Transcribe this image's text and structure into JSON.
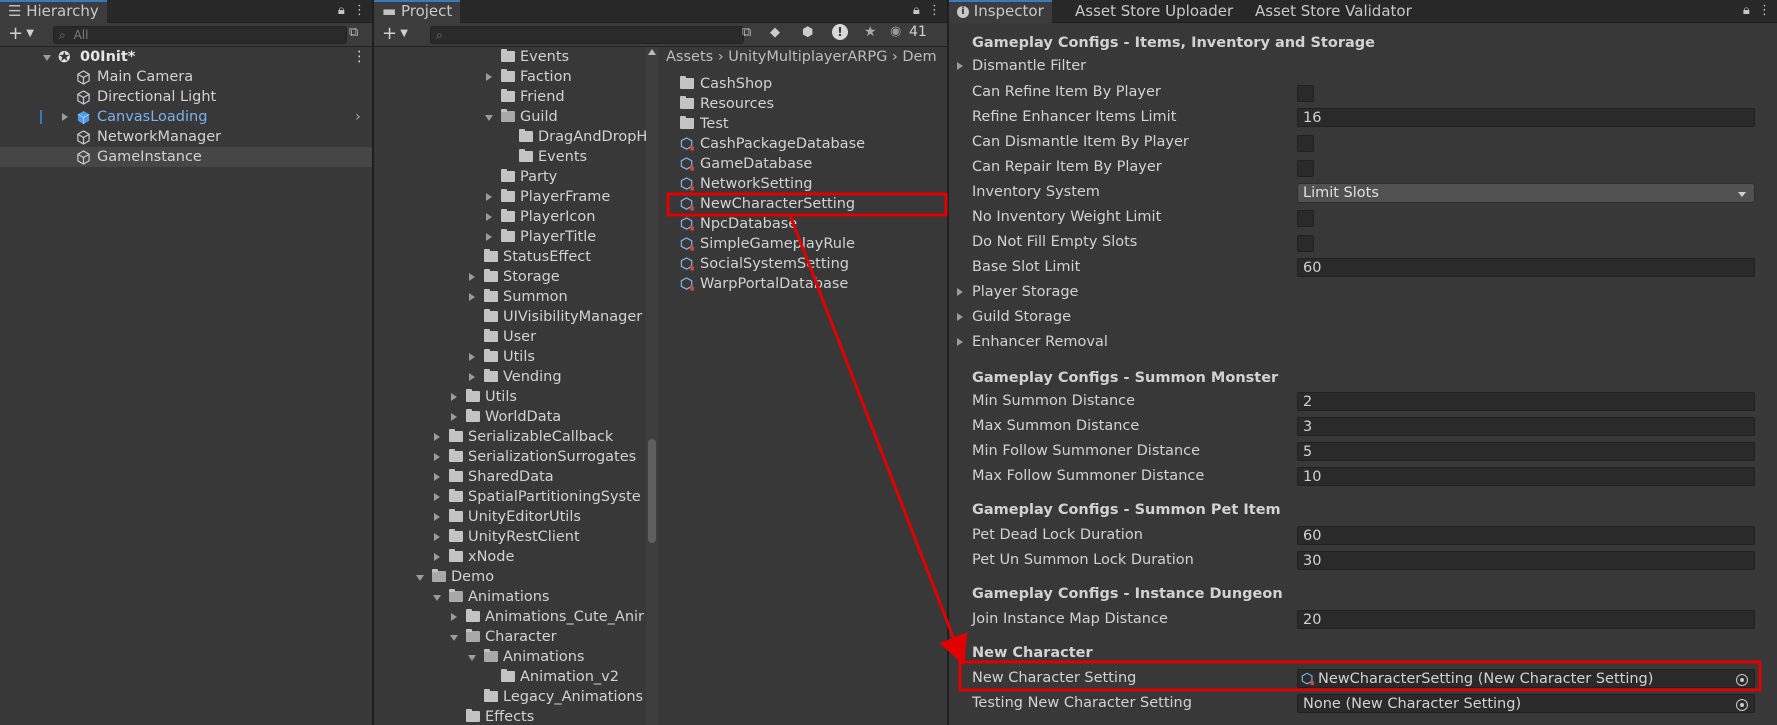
{
  "hierarchy": {
    "tab_label": "Hierarchy",
    "search_placeholder": "All",
    "scene": "00Init*",
    "items": [
      {
        "label": "Main Camera"
      },
      {
        "label": "Directional Light"
      },
      {
        "label": "CanvasLoading"
      },
      {
        "label": "NetworkManager"
      },
      {
        "label": "GameInstance"
      }
    ]
  },
  "project": {
    "tab_label": "Project",
    "hidden_count": "41",
    "breadcrumb": [
      "Assets",
      "UnityMultiplayerARPG",
      "Dem"
    ],
    "tree": [
      {
        "label": "Events"
      },
      {
        "label": "Faction"
      },
      {
        "label": "Friend"
      },
      {
        "label": "Guild"
      },
      {
        "label": "DragAndDropH"
      },
      {
        "label": "Events"
      },
      {
        "label": "Party"
      },
      {
        "label": "PlayerFrame"
      },
      {
        "label": "PlayerIcon"
      },
      {
        "label": "PlayerTitle"
      },
      {
        "label": "StatusEffect"
      },
      {
        "label": "Storage"
      },
      {
        "label": "Summon"
      },
      {
        "label": "UIVisibilityManager"
      },
      {
        "label": "User"
      },
      {
        "label": "Utils"
      },
      {
        "label": "Vending"
      },
      {
        "label": "Utils"
      },
      {
        "label": "WorldData"
      },
      {
        "label": "SerializableCallback"
      },
      {
        "label": "SerializationSurrogates"
      },
      {
        "label": "SharedData"
      },
      {
        "label": "SpatialPartitioningSyste"
      },
      {
        "label": "UnityEditorUtils"
      },
      {
        "label": "UnityRestClient"
      },
      {
        "label": "xNode"
      },
      {
        "label": "Demo"
      },
      {
        "label": "Animations"
      },
      {
        "label": "Animations_Cute_Anir"
      },
      {
        "label": "Character"
      },
      {
        "label": "Animations"
      },
      {
        "label": "Animation_v2"
      },
      {
        "label": "Legacy_Animations"
      },
      {
        "label": "Effects"
      }
    ],
    "assets": [
      {
        "label": "CashShop"
      },
      {
        "label": "Resources"
      },
      {
        "label": "Test"
      },
      {
        "label": "CashPackageDatabase"
      },
      {
        "label": "GameDatabase"
      },
      {
        "label": "NetworkSetting"
      },
      {
        "label": "NewCharacterSetting"
      },
      {
        "label": "NpcDatabase"
      },
      {
        "label": "SimpleGameplayRule"
      },
      {
        "label": "SocialSystemSetting"
      },
      {
        "label": "WarpPortalDatabase"
      }
    ]
  },
  "inspector": {
    "tabs": [
      "Inspector",
      "Asset Store Uploader",
      "Asset Store Validator"
    ],
    "headers": {
      "items": "Gameplay Configs - Items, Inventory and Storage",
      "summon_monster": "Gameplay Configs - Summon Monster",
      "summon_pet": "Gameplay Configs - Summon Pet Item",
      "dungeon": "Gameplay Configs - Instance Dungeon",
      "new_character": "New Character"
    },
    "dismantle_filter": "Dismantle Filter",
    "can_refine": "Can Refine Item By Player",
    "refine_limit": {
      "label": "Refine Enhancer Items Limit",
      "value": "16"
    },
    "can_dismantle": "Can Dismantle Item By Player",
    "can_repair": "Can Repair Item By Player",
    "inventory_system": {
      "label": "Inventory System",
      "value": "Limit Slots"
    },
    "no_weight_limit": "No Inventory Weight Limit",
    "no_fill_empty": "Do Not Fill Empty Slots",
    "base_slot_limit": {
      "label": "Base Slot Limit",
      "value": "60"
    },
    "player_storage": "Player Storage",
    "guild_storage": "Guild Storage",
    "enhancer_removal": "Enhancer Removal",
    "min_summon": {
      "label": "Min Summon Distance",
      "value": "2"
    },
    "max_summon": {
      "label": "Max Summon Distance",
      "value": "3"
    },
    "min_follow": {
      "label": "Min Follow Summoner Distance",
      "value": "5"
    },
    "max_follow": {
      "label": "Max Follow Summoner Distance",
      "value": "10"
    },
    "pet_dead": {
      "label": "Pet Dead Lock Duration",
      "value": "60"
    },
    "pet_unsummon": {
      "label": "Pet Un Summon Lock Duration",
      "value": "30"
    },
    "join_distance": {
      "label": "Join Instance Map Distance",
      "value": "20"
    },
    "new_char_setting": {
      "label": "New Character Setting",
      "value": "NewCharacterSetting (New Character Setting)"
    },
    "testing_new_char": {
      "label": "Testing New Character Setting",
      "value": "None (New Character Setting)"
    }
  },
  "colors": {
    "highlight": "#e10000",
    "prefab_blue": "#7bb0ef",
    "accent": "#3a79bb"
  }
}
